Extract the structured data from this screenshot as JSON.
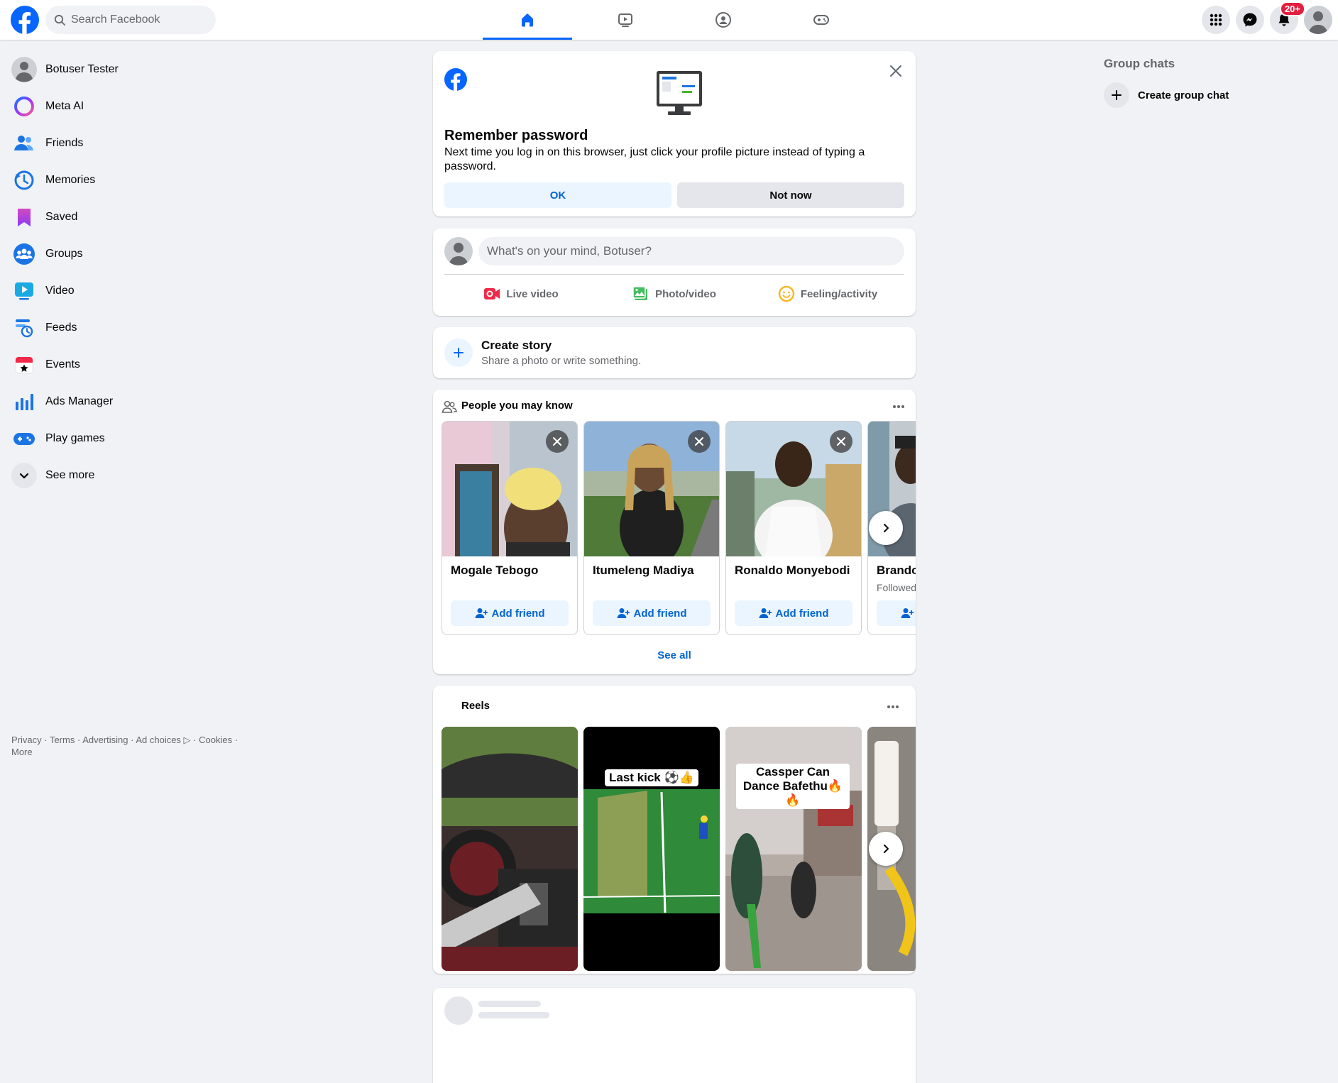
{
  "search": {
    "placeholder": "Search Facebook"
  },
  "notifications": {
    "badge": "20+"
  },
  "sidebar": {
    "items": [
      {
        "label": "Botuser Tester",
        "icon": "profile-avatar"
      },
      {
        "label": "Meta AI",
        "icon": "meta-ai-icon"
      },
      {
        "label": "Friends",
        "icon": "friends-icon"
      },
      {
        "label": "Memories",
        "icon": "memories-icon"
      },
      {
        "label": "Saved",
        "icon": "saved-icon"
      },
      {
        "label": "Groups",
        "icon": "groups-icon"
      },
      {
        "label": "Video",
        "icon": "video-icon"
      },
      {
        "label": "Feeds",
        "icon": "feeds-icon"
      },
      {
        "label": "Events",
        "icon": "events-icon"
      },
      {
        "label": "Ads Manager",
        "icon": "ads-manager-icon"
      },
      {
        "label": "Play games",
        "icon": "play-games-icon"
      },
      {
        "label": "See more",
        "icon": "chevron-down-icon"
      }
    ]
  },
  "footer": {
    "privacy": "Privacy",
    "terms": "Terms",
    "advertising": "Advertising",
    "ad_choices": "Ad choices",
    "cookies": "Cookies",
    "more": "More"
  },
  "remember_password": {
    "title": "Remember password",
    "body": "Next time you log in on this browser, just click your profile picture instead of typing a password.",
    "ok_label": "OK",
    "not_now_label": "Not now"
  },
  "composer": {
    "placeholder": "What's on your mind, Botuser?",
    "live_video": "Live video",
    "photo_video": "Photo/video",
    "feeling_activity": "Feeling/activity"
  },
  "story": {
    "title": "Create story",
    "subtitle": "Share a photo or write something."
  },
  "pymk": {
    "title": "People you may know",
    "add_friend": "Add friend",
    "see_all": "See all",
    "people": [
      {
        "name": "Mogale Tebogo",
        "subtitle": ""
      },
      {
        "name": "Itumeleng Madiya",
        "subtitle": ""
      },
      {
        "name": "Ronaldo Monyebodi",
        "subtitle": ""
      },
      {
        "name": "Brando",
        "subtitle": "Followed"
      }
    ]
  },
  "reels": {
    "title": "Reels",
    "captions": [
      "",
      "Last kick ⚽👍",
      "Cassper Can Dance Bafethu🔥🔥",
      ""
    ]
  },
  "right": {
    "group_chats_title": "Group chats",
    "create_group_chat": "Create group chat"
  },
  "colors": {
    "brand": "#0866ff",
    "background": "#f0f2f5",
    "badge": "#e41e3f"
  }
}
